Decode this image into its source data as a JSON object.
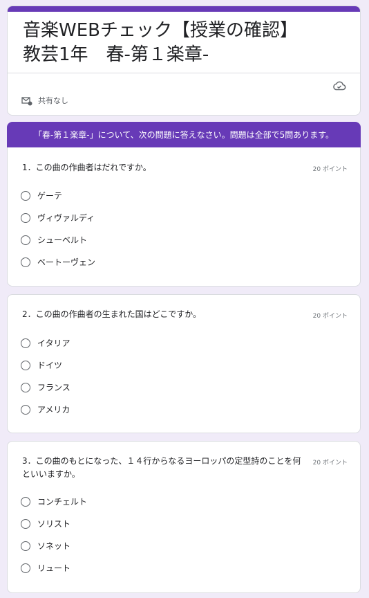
{
  "header": {
    "title": "音楽WEBチェック【授業の確認】\n教芸1年　春-第１楽章-",
    "share_status": "共有なし",
    "icons": {
      "cloud": "cloud-saved-icon",
      "mail": "mail-shared-icon"
    }
  },
  "section": {
    "banner": "「春-第１楽章-」について、次の問題に答えなさい。問題は全部で5問あります。"
  },
  "questions": [
    {
      "text": "1．この曲の作曲者はだれですか。",
      "points": "20 ポイント",
      "options": [
        "ゲーテ",
        "ヴィヴァルディ",
        "シューベルト",
        "ベートーヴェン"
      ]
    },
    {
      "text": "2．この曲の作曲者の生まれた国はどこですか。",
      "points": "20 ポイント",
      "options": [
        "イタリア",
        "ドイツ",
        "フランス",
        "アメリカ"
      ]
    },
    {
      "text": "3．この曲のもとになった、１４行からなるヨーロッパの定型詩のことを何といいますか。",
      "points": "20 ポイント",
      "options": [
        "コンチェルト",
        "ソリスト",
        "ソネット",
        "リュート"
      ]
    }
  ],
  "colors": {
    "accent": "#673ab7",
    "background": "#f0ebf8"
  }
}
